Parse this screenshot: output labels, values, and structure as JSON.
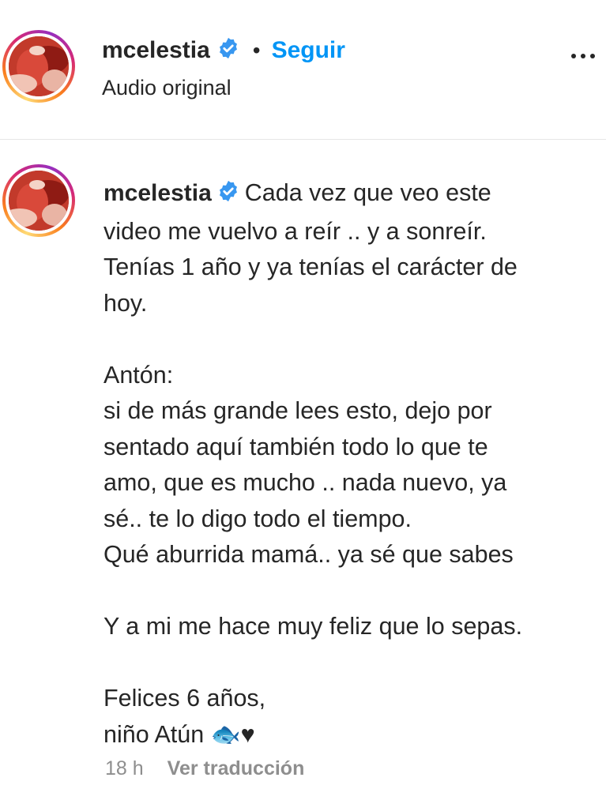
{
  "header": {
    "username": "mcelestia",
    "separator": "•",
    "follow_label": "Seguir",
    "audio_label": "Audio original",
    "more_icon": "more-horizontal-icon"
  },
  "comment": {
    "username": "mcelestia",
    "lines": [
      "Cada vez que veo este",
      "video me vuelvo a reír .. y a sonreír.",
      "Tenías 1 año y ya tenías el carácter de",
      "hoy.",
      "",
      "Antón:",
      "si de más grande lees esto, dejo por",
      "sentado aquí también todo lo que te",
      "amo, que es mucho .. nada nuevo, ya",
      "sé.. te lo digo todo el tiempo.",
      "Qué aburrida mamá.. ya sé que sabes",
      "",
      "Y a mi me hace muy feliz que lo sepas.",
      "",
      "Felices 6 años,",
      "niño Atún 🐟♥"
    ],
    "time": "18 h",
    "translate_label": "Ver traducción"
  },
  "colors": {
    "accent": "#0095f6",
    "verified": "#3897f0",
    "muted": "#8e8e8e",
    "text": "#262626"
  }
}
